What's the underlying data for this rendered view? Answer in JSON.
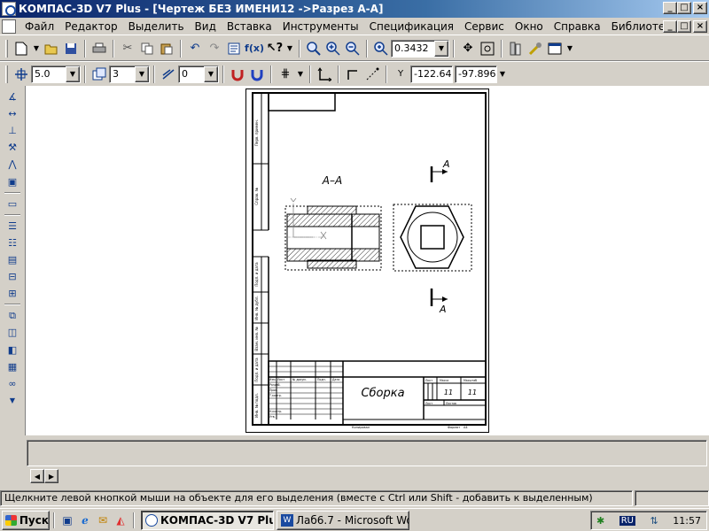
{
  "window": {
    "title": "КОМПАС-3D V7 Plus - [Чертеж БЕЗ ИМЕНИ12 ->Разрез А-А]",
    "controls": [
      "_",
      "□",
      "×"
    ]
  },
  "menu": {
    "items": [
      "Файл",
      "Редактор",
      "Выделить",
      "Вид",
      "Вставка",
      "Инструменты",
      "Спецификация",
      "Сервис",
      "Окно",
      "Справка",
      "Библиотеки"
    ],
    "mdi_controls": [
      "_",
      "□",
      "×"
    ]
  },
  "toolbar1": {
    "icons": [
      "new-icon",
      "open-icon",
      "save-icon",
      "print-icon",
      "cut-icon",
      "copy-icon",
      "paste-icon",
      "undo-icon",
      "redo-icon",
      "properties-icon",
      "fx-icon",
      "help-pointer-icon",
      "zoom-in-icon",
      "zoom-window-icon",
      "zoom-out-icon",
      "zoom-scale-icon",
      "pan-icon",
      "zoom-fit-icon",
      "library-manager-icon",
      "tools-icon",
      "view-icon"
    ],
    "fx_label": "f(x)",
    "zoom_value": "0.3432"
  },
  "toolbar2": {
    "step_value": "5.0",
    "layer_value": "3",
    "style_value": "0",
    "coord_x": "-122.64",
    "coord_y": "-97.896",
    "coord_label": "Y"
  },
  "drawing": {
    "section_label": "А–А",
    "cut_label_top": "А",
    "cut_label_bottom": "А",
    "title_block_name": "Сборка",
    "sheet_num": "11",
    "sheets_total": "11",
    "lit": "Лист",
    "sheets": "Листов",
    "mass": "Масса",
    "scale": "Масштаб",
    "copied": "Копировал",
    "format": "Формат",
    "format_value": "А4",
    "side_labels": [
      "Перв. примен.",
      "Справ. №",
      "Подп. и дата",
      "Инв. № дубл.",
      "Взам. инв. №",
      "Подп. и дата",
      "Инв. № подл."
    ],
    "row_labels": [
      "Изм.",
      "Лист",
      "№ докум.",
      "Подп.",
      "Дата",
      "Разраб.",
      "Пров.",
      "Т.контр.",
      "Н.контр.",
      "Утв."
    ]
  },
  "status": {
    "message": "Щелкните левой кнопкой мыши на объекте для его выделения (вместе с Ctrl или Shift - добавить к выделенным)"
  },
  "taskbar": {
    "start_label": "Пуск",
    "tasks": [
      "КОМПАС-3D V7 Plus - [...",
      "Лаб6.7 - Microsoft Word"
    ],
    "lang": "RU",
    "clock": "11:57"
  },
  "colors": {
    "titlebar": "#0a246a",
    "face": "#d4d0c8",
    "canvas": "#ffffff"
  }
}
